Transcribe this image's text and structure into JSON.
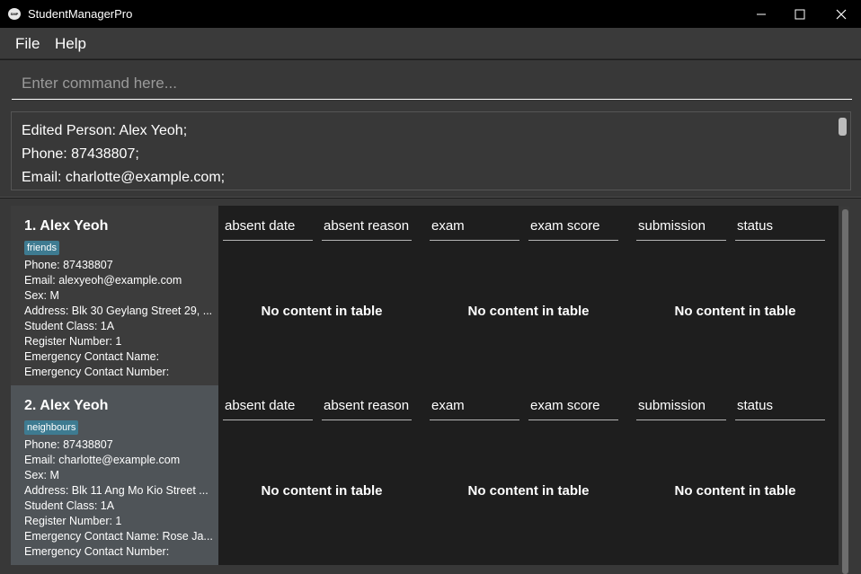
{
  "window": {
    "title": "StudentManagerPro",
    "icon_name": "app-logo-icon"
  },
  "menu": {
    "items": [
      {
        "label": "File"
      },
      {
        "label": "Help"
      }
    ]
  },
  "command": {
    "placeholder": "Enter command here...",
    "value": ""
  },
  "result": {
    "lines": [
      "Edited Person: Alex Yeoh;",
      "Phone: 87438807;",
      "Email: charlotte@example.com;"
    ]
  },
  "table_headers": [
    "absent date",
    "absent reason",
    "exam",
    "exam score",
    "submission",
    "status"
  ],
  "empty_message": "No content in table",
  "persons": [
    {
      "title": "1. Alex Yeoh",
      "tag": "friends",
      "phone": "Phone: 87438807",
      "email": "Email: alexyeoh@example.com",
      "sex": "Sex: M",
      "address": "Address: Blk 30 Geylang Street 29, ...",
      "student_class": "Student Class: 1A",
      "register_number": "Register Number: 1",
      "emergency_name": "Emergency Contact Name:",
      "emergency_number": "Emergency Contact Number:"
    },
    {
      "title": "2. Alex Yeoh",
      "tag": "neighbours",
      "phone": "Phone: 87438807",
      "email": "Email: charlotte@example.com",
      "sex": "Sex: M",
      "address": "Address: Blk 11 Ang Mo Kio Street ...",
      "student_class": "Student Class: 1A",
      "register_number": "Register Number: 1",
      "emergency_name": "Emergency Contact Name: Rose Ja...",
      "emergency_number": "Emergency Contact Number:"
    }
  ],
  "colors": {
    "background": "#383838",
    "title_bar": "#000000",
    "selected_card": "#4f5458",
    "tag": "#3e7b91"
  }
}
